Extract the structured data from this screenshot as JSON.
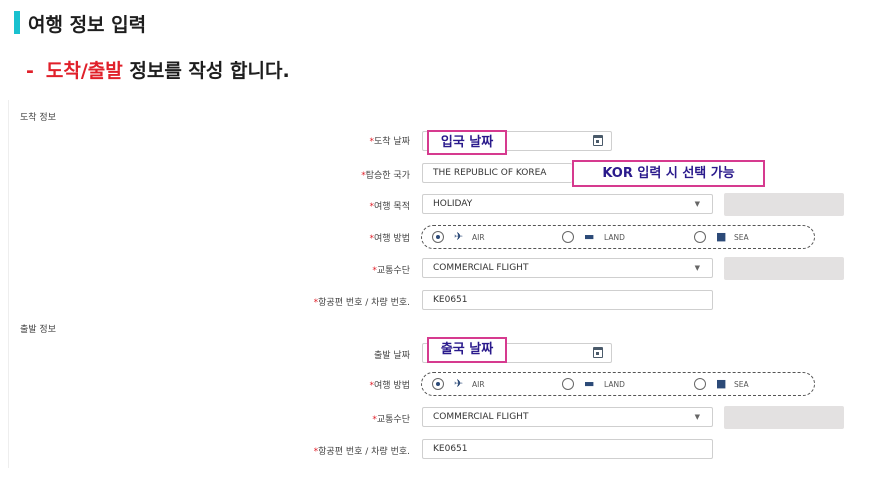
{
  "header": {
    "title": "여행 정보 입력",
    "subtitle_dash": "-",
    "subtitle_highlight": "도착/출발",
    "subtitle_rest": " 정보를 작성 합니다."
  },
  "arrival": {
    "section_title": "도착 정보",
    "date_label": "도착 날짜",
    "country_label": "탑승한 국가",
    "country_value": "THE REPUBLIC OF KOREA",
    "purpose_label": "여행 목적",
    "purpose_value": "HOLIDAY",
    "method_label": "여행 방법",
    "transport_label": "교통수단",
    "transport_value": "COMMERCIAL FLIGHT",
    "flight_label": "항공편 번호 / 차량 번호.",
    "flight_value": "KE0651"
  },
  "departure": {
    "section_title": "출발 정보",
    "date_label": "출발 날짜",
    "method_label": "여행 방법",
    "transport_label": "교통수단",
    "transport_value": "COMMERCIAL FLIGHT",
    "flight_label": "항공편 번호 / 차량 번호.",
    "flight_value": "KE0651"
  },
  "methods": {
    "air": "AIR",
    "land": "LAND",
    "sea": "SEA",
    "selected": "air"
  },
  "required_mark": "*",
  "callouts": {
    "arrival_date": "입국 날짜",
    "country_note": "KOR 입력 시 선택 가능",
    "departure_date": "출국 날짜"
  },
  "colors": {
    "accent_bar": "#19c1cf",
    "highlight_red": "#e0202a",
    "callout_border": "#d63a8f",
    "callout_text": "#2a1a8c"
  },
  "icons": [
    "calendar-icon",
    "chevron-down-icon",
    "airplane-icon",
    "car-icon",
    "train-icon"
  ]
}
